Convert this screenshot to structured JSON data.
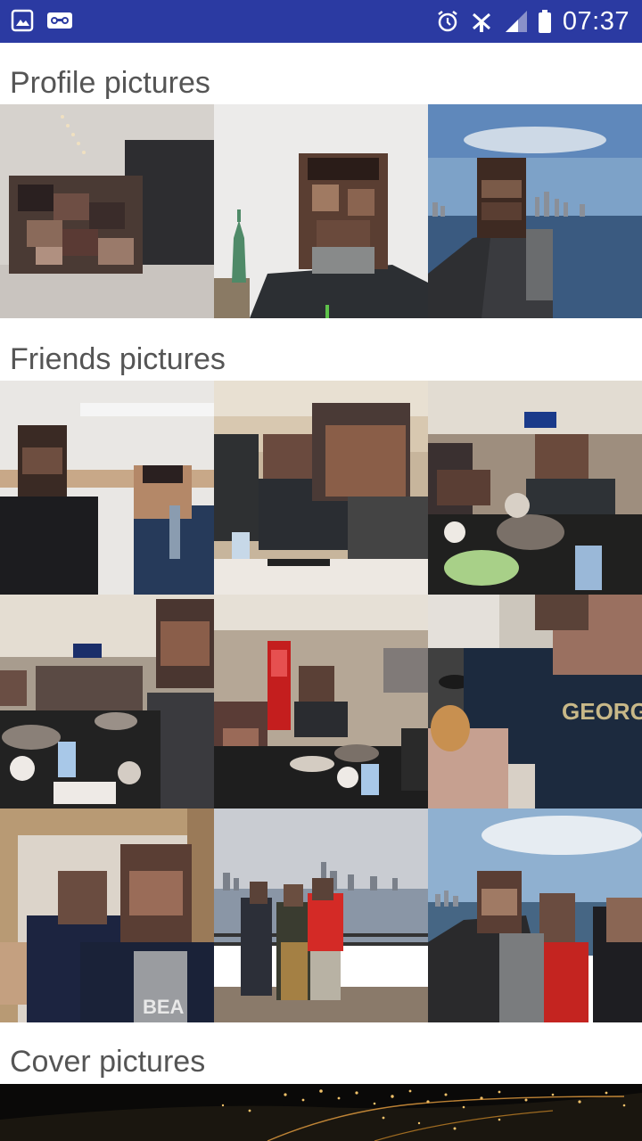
{
  "status_bar": {
    "time": "07:37",
    "left_icons": [
      "image-notification-icon",
      "voicemail-icon"
    ],
    "right_icons": [
      "alarm-icon",
      "no-signal-icon",
      "signal-bars-icon",
      "battery-icon"
    ],
    "bar_color": "#2b3aa2"
  },
  "sections": {
    "profile": {
      "title": "Profile pictures"
    },
    "friends": {
      "title": "Friends pictures"
    },
    "cover": {
      "title": "Cover pictures"
    }
  },
  "profile_photos": [
    {
      "kind": "selfie-indoor",
      "bg": "#d8d4cf"
    },
    {
      "kind": "statue-of-liberty-selfie",
      "bg": "#ecebea"
    },
    {
      "kind": "skyline-selfie",
      "bg": "#7fa3c7"
    }
  ],
  "friends_photos": [
    {
      "kind": "two-people-indoor",
      "bg": "#e8e6e2"
    },
    {
      "kind": "restaurant-dinner",
      "bg": "#b9a58a"
    },
    {
      "kind": "hotpot-table",
      "bg": "#a89a88"
    },
    {
      "kind": "group-dinner",
      "bg": "#a69a8c"
    },
    {
      "kind": "restaurant-coca-cola",
      "bg": "#b8a898"
    },
    {
      "kind": "georgia-sweater-eating",
      "bg": "#c8c2b8"
    },
    {
      "kind": "selfie-champion",
      "bg": "#d8d0c6"
    },
    {
      "kind": "three-friends-waterfront",
      "bg": "#c9ccd0"
    },
    {
      "kind": "friends-skyline-selfie",
      "bg": "#8eaac8"
    }
  ],
  "colors": {
    "title_text": "#555555",
    "background": "#ffffff"
  }
}
